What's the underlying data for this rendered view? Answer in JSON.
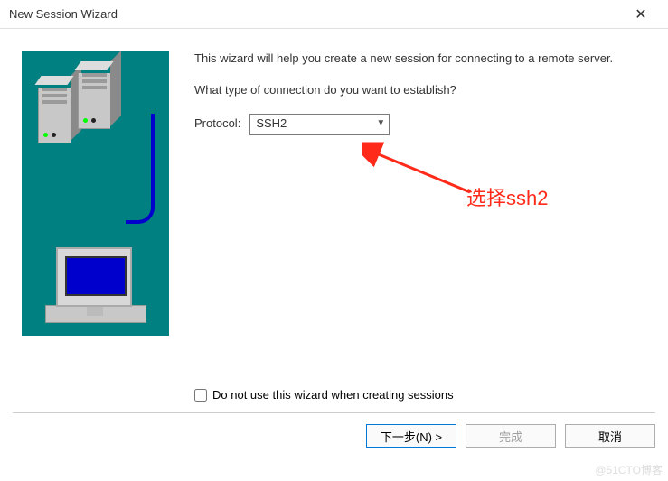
{
  "window": {
    "title": "New Session Wizard",
    "close_glyph": "✕"
  },
  "wizard": {
    "intro": "This wizard will help you create a new session for connecting to a remote server.",
    "question": "What type of connection do you want to establish?",
    "protocol_label": "Protocol:",
    "protocol_value": "SSH2"
  },
  "annotation": {
    "text": "选择ssh2"
  },
  "checkbox": {
    "label": "Do not use this wizard when creating sessions"
  },
  "buttons": {
    "next": "下一步(N) >",
    "finish": "完成",
    "cancel": "取消"
  },
  "watermark": "@51CTO博客"
}
